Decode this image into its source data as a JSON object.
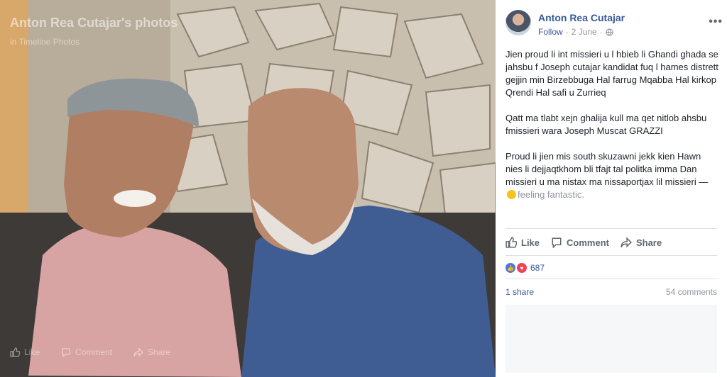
{
  "photo": {
    "album_title": "Anton Rea Cutajar's photos",
    "album_subtitle": "in Timeline Photos",
    "actions": {
      "like": "Like",
      "comment": "Comment",
      "share": "Share"
    }
  },
  "post": {
    "author": "Anton Rea Cutajar",
    "follow": "Follow",
    "separator": "·",
    "date": "2 June",
    "more": "•••",
    "paragraphs": [
      "Jien proud li int missieri u l hbieb li Ghandi ghada se jahsbu f Joseph cutajar kandidat fuq l hames distrett gejjin min Birzebbuga Hal farrug Mqabba Hal kirkop Qrendi Hal safi u Zurrieq",
      "Qatt ma tlabt xejn ghalija kull ma qet nitlob ahsbu fmissieri wara Joseph Muscat GRAZZI",
      "Proud li jien mis south skuzawni jekk kien Hawn nies li dejjaqtkhom bli tfajt tal politka imma Dan missieri u ma nistax ma nissaportjax lil missieri —"
    ],
    "feeling_text": "feeling fantastic.",
    "actions": {
      "like": "Like",
      "comment": "Comment",
      "share": "Share"
    },
    "reaction_count": "687",
    "shares": "1 share",
    "comments": "54 comments"
  },
  "colors": {
    "link": "#385898",
    "muted": "#90949c",
    "like": "#4a76e8",
    "love": "#f0405a"
  }
}
